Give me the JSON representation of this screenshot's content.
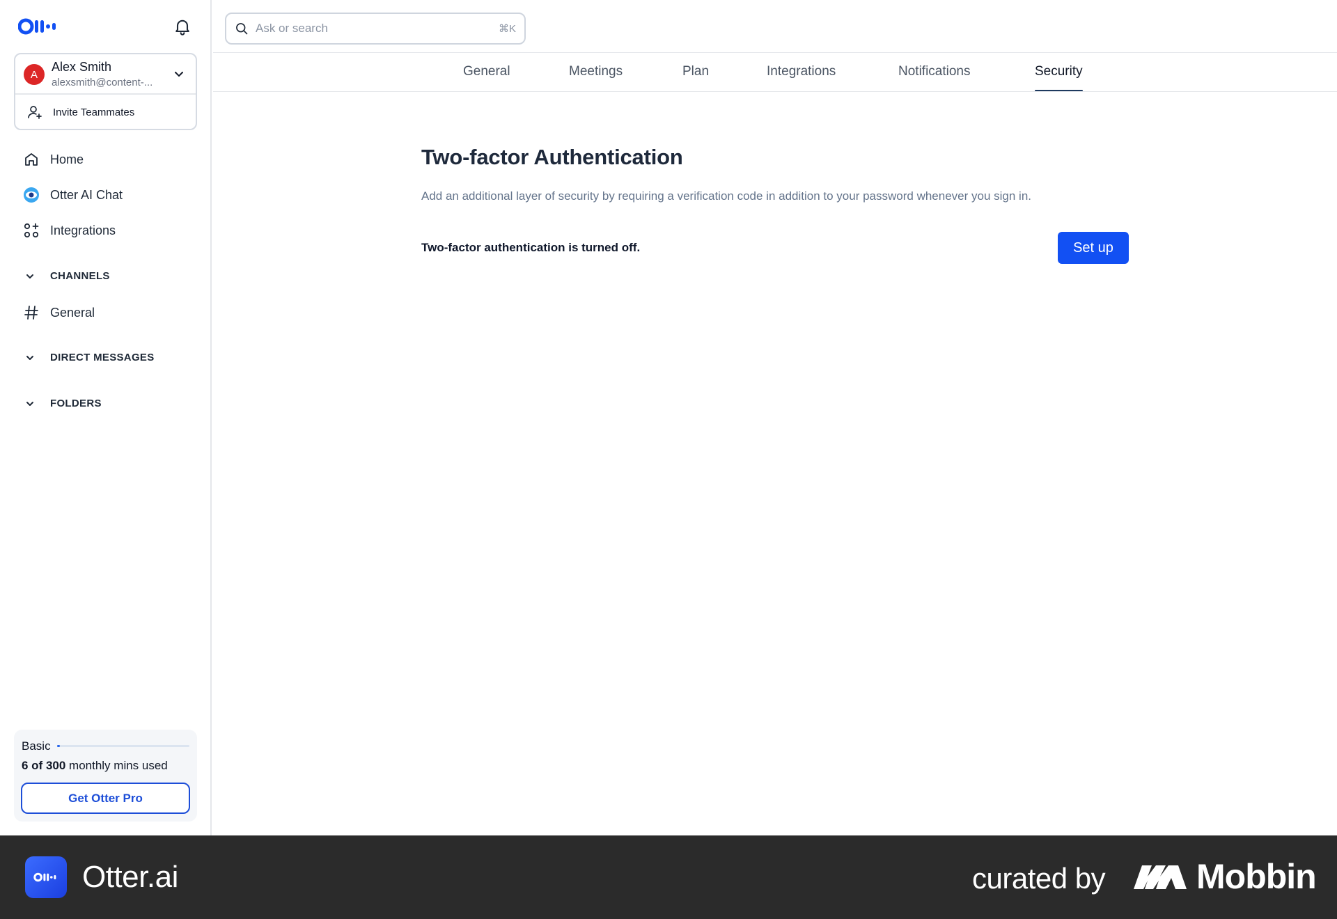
{
  "sidebar": {
    "account": {
      "avatar_letter": "A",
      "name": "Alex Smith",
      "email": "alexsmith@content-..."
    },
    "invite_label": "Invite Teammates",
    "nav": [
      {
        "label": "Home",
        "icon": "home-icon"
      },
      {
        "label": "Otter AI Chat",
        "icon": "otter-ai-chat-icon"
      },
      {
        "label": "Integrations",
        "icon": "integrations-icon"
      }
    ],
    "sections": {
      "channels": "CHANNELS",
      "channel_general": "General",
      "direct_messages": "DIRECT MESSAGES",
      "folders": "FOLDERS"
    },
    "plan": {
      "name": "Basic",
      "used": "6 of 300",
      "used_suffix": " monthly mins used",
      "usage_fraction": 0.02,
      "cta": "Get Otter Pro"
    }
  },
  "search": {
    "placeholder": "Ask or search",
    "shortcut": "⌘K"
  },
  "tabs": [
    {
      "label": "General",
      "active": false
    },
    {
      "label": "Meetings",
      "active": false
    },
    {
      "label": "Plan",
      "active": false
    },
    {
      "label": "Integrations",
      "active": false
    },
    {
      "label": "Notifications",
      "active": false
    },
    {
      "label": "Security",
      "active": true
    }
  ],
  "security": {
    "title": "Two-factor Authentication",
    "description": "Add an additional layer of security by requiring a verification code in addition to your password whenever you sign in.",
    "status": "Two-factor authentication is turned off.",
    "setup_label": "Set up"
  },
  "footer": {
    "app_name": "Otter.ai",
    "curated_by": "curated by",
    "brand": "Mobbin"
  },
  "colors": {
    "accent": "#1250f3",
    "avatar": "#dc2626",
    "footer_bg": "#2b2b2b"
  }
}
